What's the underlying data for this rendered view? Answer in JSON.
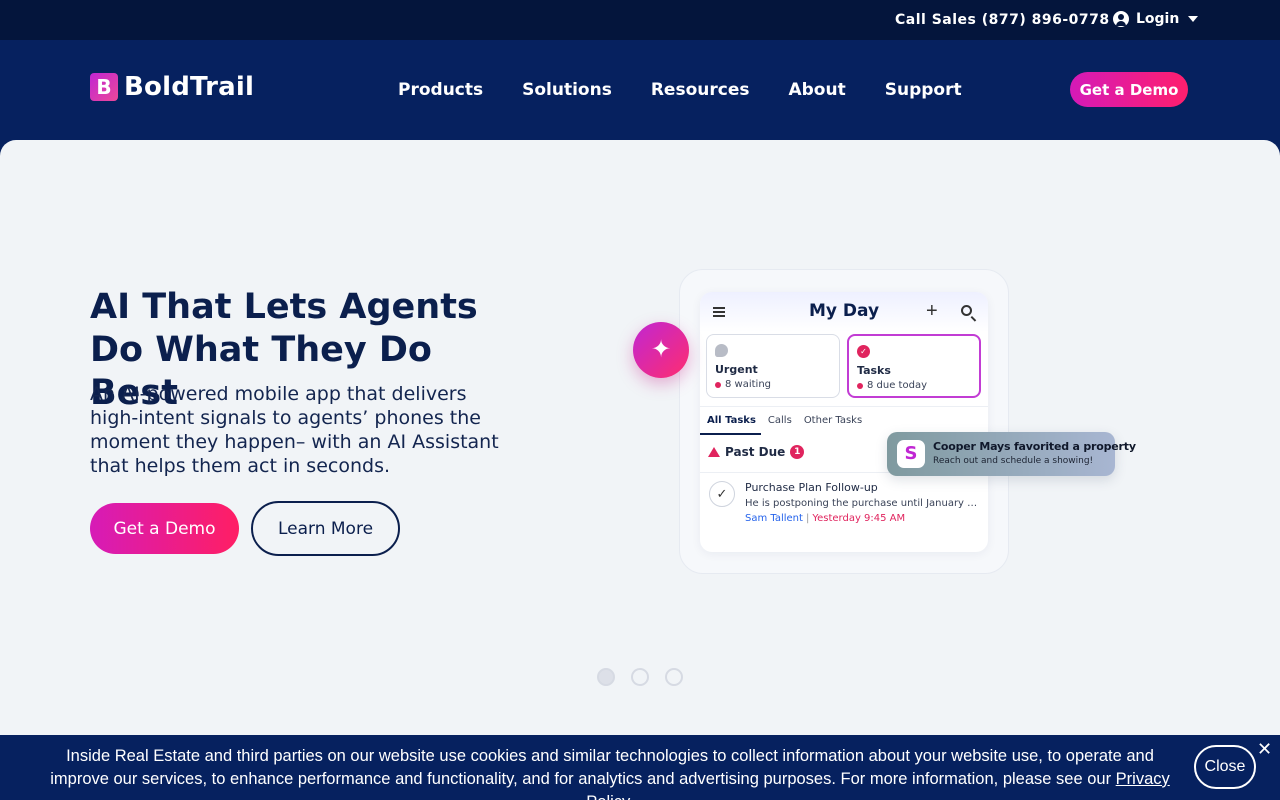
{
  "topbar": {
    "call_sales": "Call Sales (877) 896-0778",
    "login_label": "Login"
  },
  "nav": {
    "logo_mark": "B",
    "logo_text": "BoldTrail",
    "items": [
      "Products",
      "Solutions",
      "Resources",
      "About",
      "Support"
    ],
    "demo_label": "Get a Demo"
  },
  "hero": {
    "title": "AI That Lets Agents Do What They Do Best",
    "subtitle": "An AI-powered mobile app that delivers high-intent signals to agents’ phones the moment they happen– with an AI Assistant that helps them act in seconds.",
    "demo_label": "Get a Demo",
    "learn_label": "Learn More"
  },
  "phone": {
    "title": "My Day",
    "cards": [
      {
        "title": "Urgent",
        "sub": "8 waiting"
      },
      {
        "title": "Tasks",
        "sub": "8 due today"
      }
    ],
    "tabs": [
      "All Tasks",
      "Calls",
      "Other Tasks"
    ],
    "past_due_label": "Past Due",
    "past_due_count": "1",
    "task": {
      "title": "Purchase Plan Follow-up",
      "desc": "He is postponing the purchase until January or...",
      "who": "Sam Tallent",
      "when": "Yesterday 9:45 AM"
    }
  },
  "toast": {
    "icon_letter": "S",
    "title": "Cooper Mays favorited a property",
    "sub": "Reach out and schedule a showing!"
  },
  "carousel": {
    "count": 3,
    "active": 0
  },
  "cookie": {
    "message": "Inside Real Estate and third parties on our website use cookies and similar technologies to collect information about your website use, to operate and improve our services, to enhance performance and functionality, and for analytics and advertising purposes.  For more information, please see our",
    "link_label": "Privacy Policy",
    "suffix": ".",
    "close_label": "Close",
    "x_label": "✕"
  },
  "colors": {
    "navy": "#06215f",
    "dark_navy": "#04153c",
    "accent_pink": "#e0245e",
    "accent_magenta": "#c026d3"
  }
}
